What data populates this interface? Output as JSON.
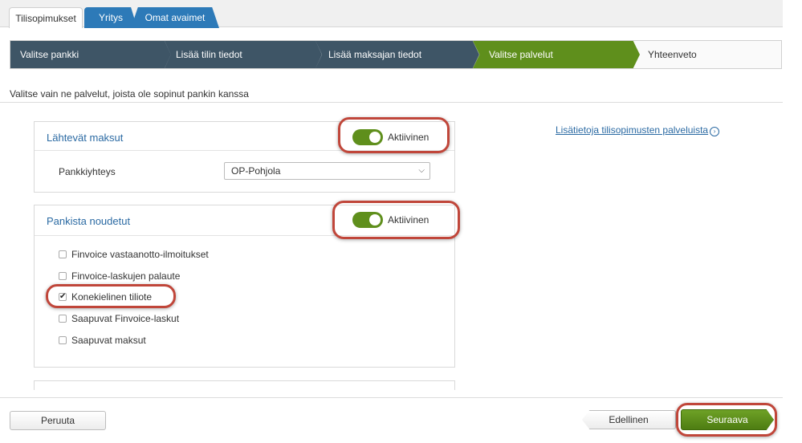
{
  "tabs": [
    {
      "label": "Tilisopimukset",
      "active": true
    },
    {
      "label": "Yritys"
    },
    {
      "label": "Omat avaimet"
    }
  ],
  "wizard": {
    "steps": [
      "Valitse pankki",
      "Lisää tilin tiedot",
      "Lisää maksajan tiedot",
      "Valitse palvelut",
      "Yhteenveto"
    ],
    "current_index": 3
  },
  "instruction": "Valitse vain ne palvelut, joista ole sopinut pankin kanssa",
  "outgoing": {
    "title": "Lähtevät maksut",
    "toggle_label": "Aktiivinen",
    "field_label": "Pankkiyhteys",
    "select_value": "OP-Pohjola"
  },
  "incoming": {
    "title": "Pankista noudetut",
    "toggle_label": "Aktiivinen",
    "items": [
      {
        "label": "Finvoice vastaanotto-ilmoitukset",
        "checked": false
      },
      {
        "label": "Finvoice-laskujen palaute",
        "checked": false
      },
      {
        "label": "Konekielinen tiliote",
        "checked": true
      },
      {
        "label": "Saapuvat Finvoice-laskut",
        "checked": false
      },
      {
        "label": "Saapuvat maksut",
        "checked": false
      }
    ]
  },
  "help_link": "Lisätietoja tilisopimusten palveluista",
  "buttons": {
    "cancel": "Peruuta",
    "previous": "Edellinen",
    "next": "Seuraava"
  },
  "colors": {
    "accent_green": "#5f8f1c",
    "step_done": "#3e5566",
    "tab_blue": "#2d7ab8",
    "highlight": "#c0463a"
  },
  "icons": {
    "info": "info-circle-icon",
    "dropdown": "chevron-down-icon",
    "check": "checkmark-icon"
  }
}
